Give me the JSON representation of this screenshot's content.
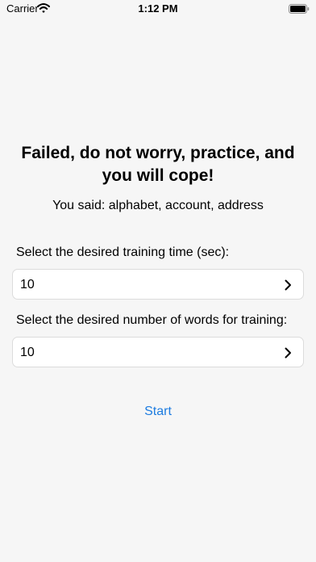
{
  "status_bar": {
    "carrier": "Carrier",
    "time": "1:12 PM",
    "icons": [
      "wifi-icon",
      "battery-icon"
    ]
  },
  "main": {
    "title": "Failed, do not worry, practice, and you will cope!",
    "result": "You said: alphabet, account, address",
    "training_time": {
      "label": "Select the desired training time (sec):",
      "value": "10",
      "icon": "chevron-right-icon"
    },
    "word_count": {
      "label": "Select the desired number of words for training:",
      "value": "10",
      "icon": "chevron-right-icon"
    },
    "start_label": "Start"
  },
  "colors": {
    "background": "#f6f6f6",
    "field_background": "#ffffff",
    "field_border": "#dcdcdc",
    "accent": "#1e7ce0"
  }
}
